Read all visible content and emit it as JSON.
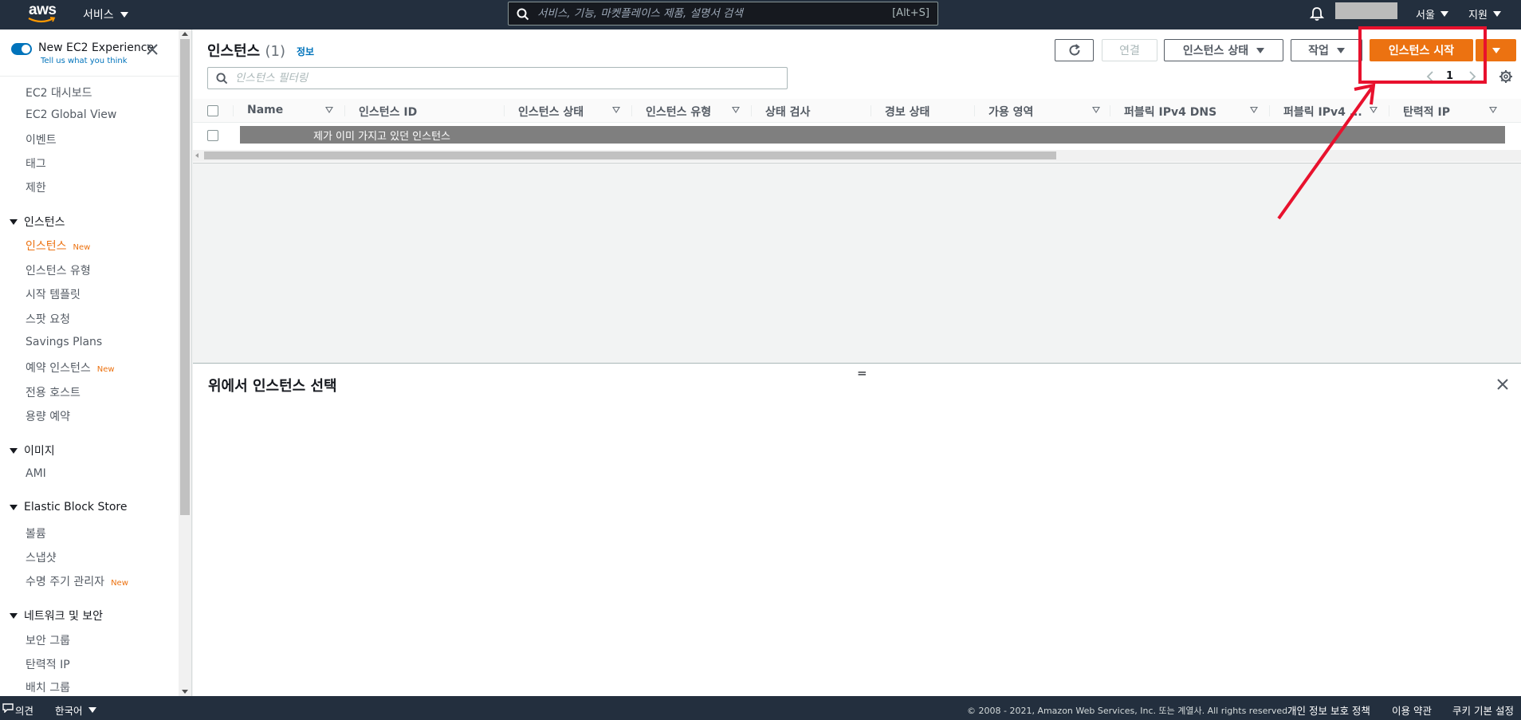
{
  "topnav": {
    "logo": "aws",
    "services_label": "서비스",
    "search_placeholder": "서비스, 기능, 마켓플레이스 제품, 설명서 검색",
    "search_hint": "[Alt+S]",
    "region_label": "서울",
    "support_label": "지원"
  },
  "sidebar": {
    "experience_title": "New EC2 Experience",
    "experience_sub": "Tell us what you think",
    "top_items": [
      "EC2 대시보드",
      "EC2 Global View",
      "이벤트",
      "태그",
      "제한"
    ],
    "instances_section": "인스턴스",
    "instances_items": [
      "인스턴스",
      "인스턴스 유형",
      "시작 템플릿",
      "스팟 요청",
      "Savings Plans",
      "예약 인스턴스",
      "전용 호스트",
      "용량 예약"
    ],
    "new_tag": "New",
    "images_section": "이미지",
    "images_items": [
      "AMI"
    ],
    "ebs_section": "Elastic Block Store",
    "ebs_items": [
      "볼륨",
      "스냅샷",
      "수명 주기 관리자"
    ],
    "network_section": "네트워크 및 보안",
    "network_items": [
      "보안 그룹",
      "탄력적 IP",
      "배치 그룹"
    ]
  },
  "main": {
    "title": "인스턴스",
    "count": "(1)",
    "info_link": "정보",
    "buttons": {
      "connect": "연결",
      "instance_state": "인스턴스 상태",
      "actions": "작업",
      "launch": "인스턴스 시작"
    },
    "filter_placeholder": "인스턴스 필터링",
    "page_number": "1",
    "columns": [
      "Name",
      "인스턴스 ID",
      "인스턴스 상태",
      "인스턴스 유형",
      "상태 검사",
      "경보 상태",
      "가용 영역",
      "퍼블릭 IPv4 DNS",
      "퍼블릭 IPv4 ...",
      "탄력적 IP"
    ],
    "row_label": "제가 이미 가지고 있던 인스턴스"
  },
  "detail": {
    "title": "위에서 인스턴스 선택",
    "handle": "="
  },
  "footer": {
    "feedback": "의견",
    "language": "한국어",
    "copyright": "© 2008 - 2021, Amazon Web Services, Inc. 또는 계열사. All rights reserved.",
    "privacy": "개인 정보 보호 정책",
    "terms": "이용 약관",
    "cookies": "쿠키 기본 설정"
  },
  "colors": {
    "nav_bg": "#232f3e",
    "accent": "#ec7211",
    "link": "#0073bb",
    "annotation": "#e8112d"
  }
}
